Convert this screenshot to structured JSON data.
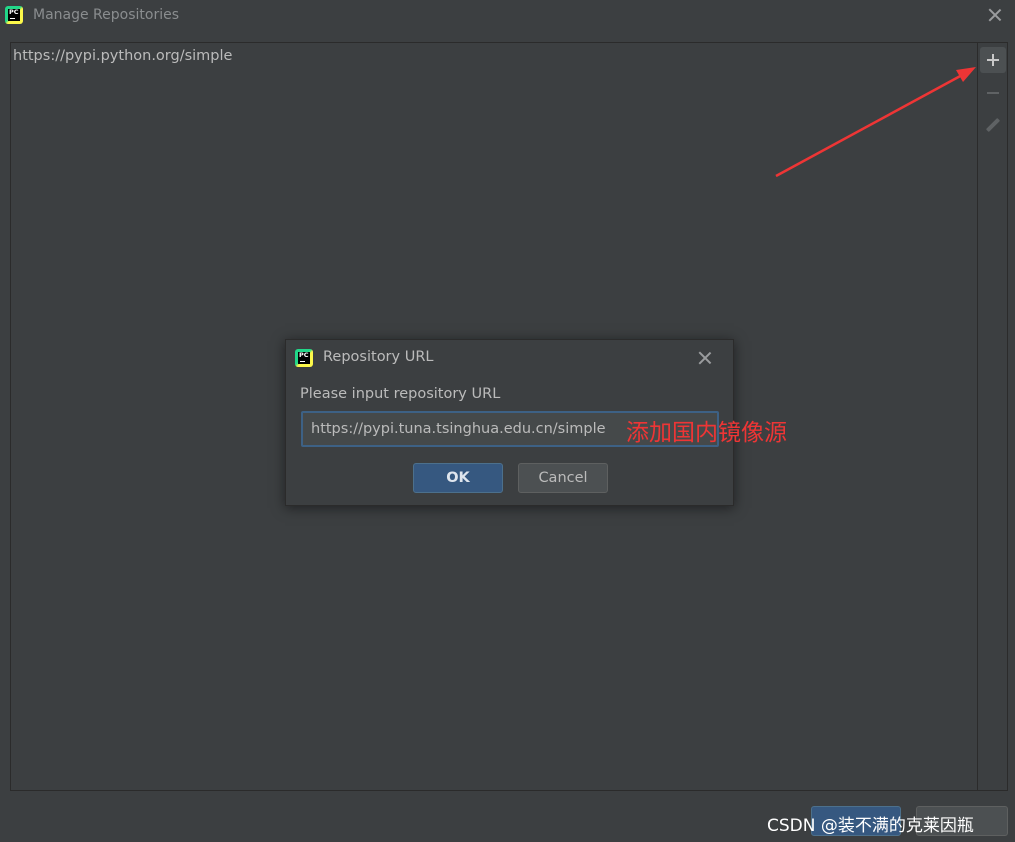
{
  "window": {
    "title": "Manage Repositories",
    "icon": "pycharm-logo-icon",
    "icon_text": "PC"
  },
  "repositories": {
    "items": [
      "https://pypi.python.org/simple"
    ]
  },
  "toolbar": {
    "add_icon": "plus-icon",
    "remove_icon": "minus-icon",
    "edit_icon": "pencil-icon"
  },
  "dialog": {
    "title": "Repository URL",
    "prompt": "Please input repository URL",
    "url_value": "https://pypi.tuna.tsinghua.edu.cn/simple",
    "annotation": "添加国内镜像源",
    "ok_label": "OK",
    "cancel_label": "Cancel"
  },
  "watermark": "CSDN @装不满的克莱因瓶",
  "colors": {
    "background": "#3c3f41",
    "accent_button": "#365880",
    "annotation_red": "#ee3535",
    "focus_border": "#3d6185"
  }
}
